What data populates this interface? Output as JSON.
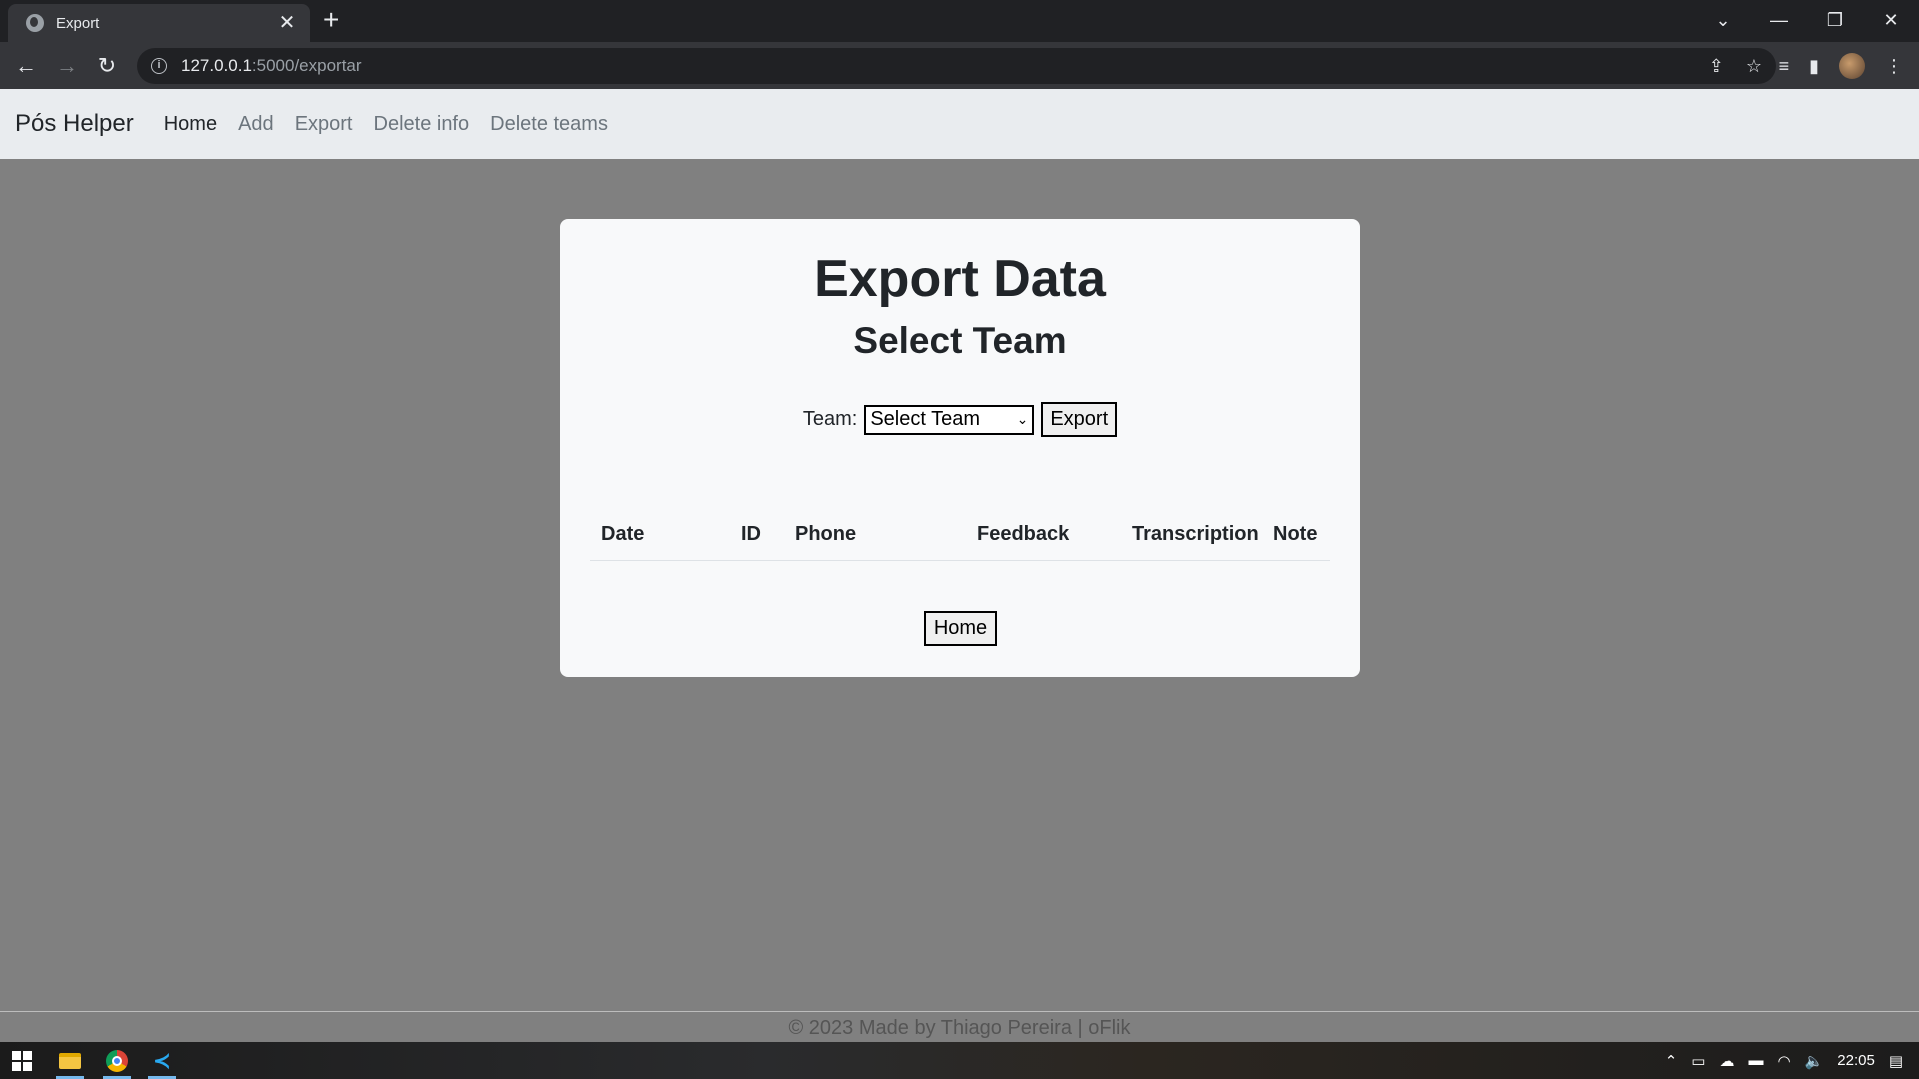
{
  "browser": {
    "tab_title": "Export",
    "url_host": "127.0.0.1",
    "url_path": ":5000/exportar"
  },
  "navbar": {
    "brand": "Pós Helper",
    "links": [
      {
        "label": "Home",
        "active": true
      },
      {
        "label": "Add",
        "active": false
      },
      {
        "label": "Export",
        "active": false
      },
      {
        "label": "Delete info",
        "active": false
      },
      {
        "label": "Delete teams",
        "active": false
      }
    ]
  },
  "card": {
    "title": "Export Data",
    "subtitle": "Select Team",
    "team_label": "Team:",
    "team_select_value": "Select Team",
    "export_button": "Export",
    "table_headers": [
      "Date",
      "ID",
      "Phone",
      "Feedback",
      "Transcription",
      "Note"
    ],
    "home_button": "Home"
  },
  "footer": {
    "text": "© 2023 Made by Thiago Pereira | oFlik"
  },
  "taskbar": {
    "clock": "22:05"
  },
  "colors": {
    "page_background": "#808080",
    "navbar_background": "#e9ecef",
    "card_background": "#f8f9fa"
  }
}
